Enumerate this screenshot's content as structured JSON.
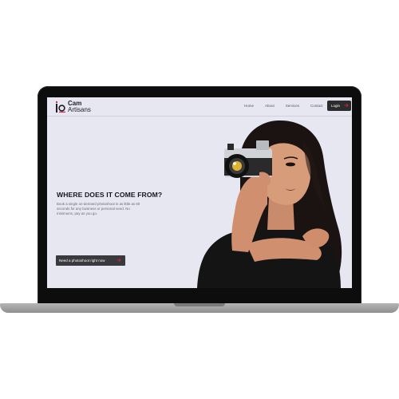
{
  "brand": {
    "name_line1": "Cam",
    "name_line2": "Artisans",
    "accent_color": "#e0213f"
  },
  "nav": {
    "links": [
      "Home",
      "About",
      "Services",
      "Contact"
    ],
    "login_label": "Login"
  },
  "hero": {
    "title": "WHERE DOES IT COME FROM?",
    "body": "Book a single on-demand photoshoot in as little as 60 seconds for any business or personal need. No minimums, pay as you go.",
    "cta_label": "Need a photoshoot right now"
  },
  "icons": {
    "logo": "camera-logo-icon",
    "login": "arrow-right-icon",
    "cta": "arrow-right-icon"
  },
  "colors": {
    "screen_bg": "#e7e7f2",
    "button_bg": "#2c2c2e"
  }
}
